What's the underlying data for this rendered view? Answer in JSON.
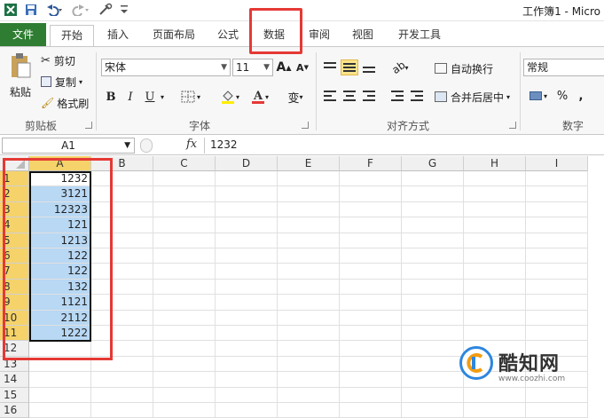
{
  "window": {
    "title": "工作簿1 - Micro"
  },
  "tabs": [
    {
      "label": "文件"
    },
    {
      "label": "开始"
    },
    {
      "label": "插入"
    },
    {
      "label": "页面布局"
    },
    {
      "label": "公式"
    },
    {
      "label": "数据"
    },
    {
      "label": "审阅"
    },
    {
      "label": "视图"
    },
    {
      "label": "开发工具"
    }
  ],
  "ribbon": {
    "clipboard": {
      "paste": "粘贴",
      "cut": "剪切",
      "copy": "复制",
      "format_painter": "格式刷",
      "group": "剪贴板"
    },
    "font": {
      "name": "宋体",
      "size": "11",
      "grow": "A",
      "shrink": "A",
      "bold": "B",
      "italic": "I",
      "underline": "U",
      "group": "字体"
    },
    "alignment": {
      "wrap": "自动换行",
      "merge": "合并后居中",
      "group": "对齐方式"
    },
    "number": {
      "format": "常规",
      "percent": "%",
      "comma": ",",
      "group": "数字"
    }
  },
  "formula_bar": {
    "name_box": "A1",
    "fx": "fx",
    "value": "1232"
  },
  "sheet": {
    "columns": [
      "A",
      "B",
      "C",
      "D",
      "E",
      "F",
      "G",
      "H",
      "I"
    ],
    "rows": [
      "1",
      "2",
      "3",
      "4",
      "5",
      "6",
      "7",
      "8",
      "9",
      "10",
      "11",
      "12",
      "13",
      "14",
      "15",
      "16"
    ],
    "col_a_values": [
      "1232",
      "3121",
      "12323",
      "121",
      "1213",
      "122",
      "122",
      "132",
      "1121",
      "2112",
      "1222"
    ]
  },
  "watermark": {
    "name": "酷知网",
    "url": "www.coozhi.com"
  },
  "colors": {
    "file_tab": "#2e7d32",
    "highlight": "#e53935",
    "selection": "#b8d8f4",
    "header_selected": "#f5d36a"
  }
}
